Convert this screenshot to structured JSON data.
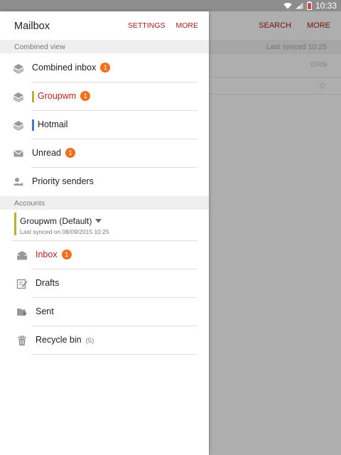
{
  "status_bar": {
    "time": "10:33"
  },
  "background": {
    "actions": [
      "SEARCH",
      "MORE"
    ],
    "last_synced": "Last synced 10:25",
    "date": "07/09"
  },
  "drawer": {
    "title": "Mailbox",
    "actions": {
      "settings": "SETTINGS",
      "more": "MORE"
    },
    "combined_view": {
      "header": "Combined view",
      "items": [
        {
          "label": "Combined inbox",
          "badge": "1",
          "icon": "inbox-stack-icon"
        },
        {
          "label": "Groupwm",
          "badge": "1",
          "icon": "inbox-stack-icon",
          "accent": "#b6b329"
        },
        {
          "label": "Hotmail",
          "icon": "inbox-stack-icon",
          "accent": "#4a78c7"
        },
        {
          "label": "Unread",
          "badge": "1",
          "icon": "envelope-icon"
        },
        {
          "label": "Priority senders",
          "icon": "priority-sender-icon"
        }
      ]
    },
    "accounts": {
      "header": "Accounts",
      "account": {
        "name": "Groupwm (Default)",
        "last_synced": "Last synced on 08/09/2015 10:25",
        "color": "#b6b329"
      },
      "folders": [
        {
          "label": "Inbox",
          "badge": "1",
          "icon": "inbox-icon"
        },
        {
          "label": "Drafts",
          "icon": "drafts-icon"
        },
        {
          "label": "Sent",
          "icon": "sent-icon"
        },
        {
          "label": "Recycle bin",
          "count": "(5)",
          "icon": "trash-icon"
        }
      ]
    }
  },
  "colors": {
    "accent_red": "#9b1a12",
    "badge_orange": "#f1701c",
    "hotmail_blue": "#4a78c7",
    "groupwm_olive": "#b6b329"
  }
}
